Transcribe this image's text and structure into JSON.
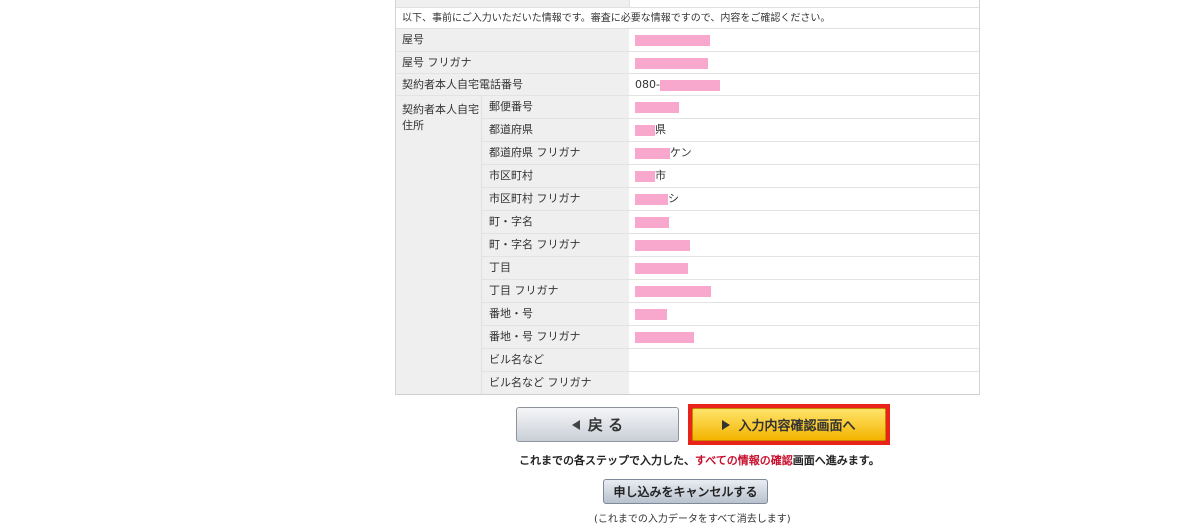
{
  "notice": "以下、事前にご入力いただいた情報です。審査に必要な情報ですので、内容をご確認ください。",
  "rows": [
    {
      "label": "屋号",
      "value": "",
      "masked": true
    },
    {
      "label": "屋号 フリガナ",
      "value": "",
      "masked": true
    },
    {
      "label": "契約者本人自宅電話番号",
      "value_prefix": "080-",
      "masked": true
    }
  ],
  "address": {
    "label": "契約者本人自宅住所",
    "label_line1": "契約者本人自宅",
    "label_line2": "住所",
    "fields": [
      {
        "label": "郵便番号",
        "suffix": ""
      },
      {
        "label": "都道府県",
        "suffix": "県"
      },
      {
        "label": "都道府県 フリガナ",
        "suffix": "ケン"
      },
      {
        "label": "市区町村",
        "suffix": "市"
      },
      {
        "label": "市区町村 フリガナ",
        "suffix": "シ"
      },
      {
        "label": "町・字名",
        "suffix": ""
      },
      {
        "label": "町・字名 フリガナ",
        "suffix": ""
      },
      {
        "label": "丁目",
        "suffix": ""
      },
      {
        "label": "丁目 フリガナ",
        "suffix": ""
      },
      {
        "label": "番地・号",
        "suffix": ""
      },
      {
        "label": "番地・号 フリガナ",
        "suffix": ""
      },
      {
        "label": "ビル名など",
        "suffix": ""
      },
      {
        "label": "ビル名など フリガナ",
        "suffix": ""
      }
    ]
  },
  "buttons": {
    "back": "戻 る",
    "next": "入力内容確認画面へ",
    "cancel": "申し込みをキャンセルする"
  },
  "note": {
    "part1": "これまでの各ステップで入力した、",
    "highlight": "すべての情報の確認",
    "part2": "画面へ進みます。"
  },
  "cancel_note": "(これまでの入力データをすべて消去します)",
  "colors": {
    "mask": "#f7a8cc",
    "highlight": "#c8102e",
    "next_frame": "#e8231a",
    "next_bg": "#f4b400"
  }
}
